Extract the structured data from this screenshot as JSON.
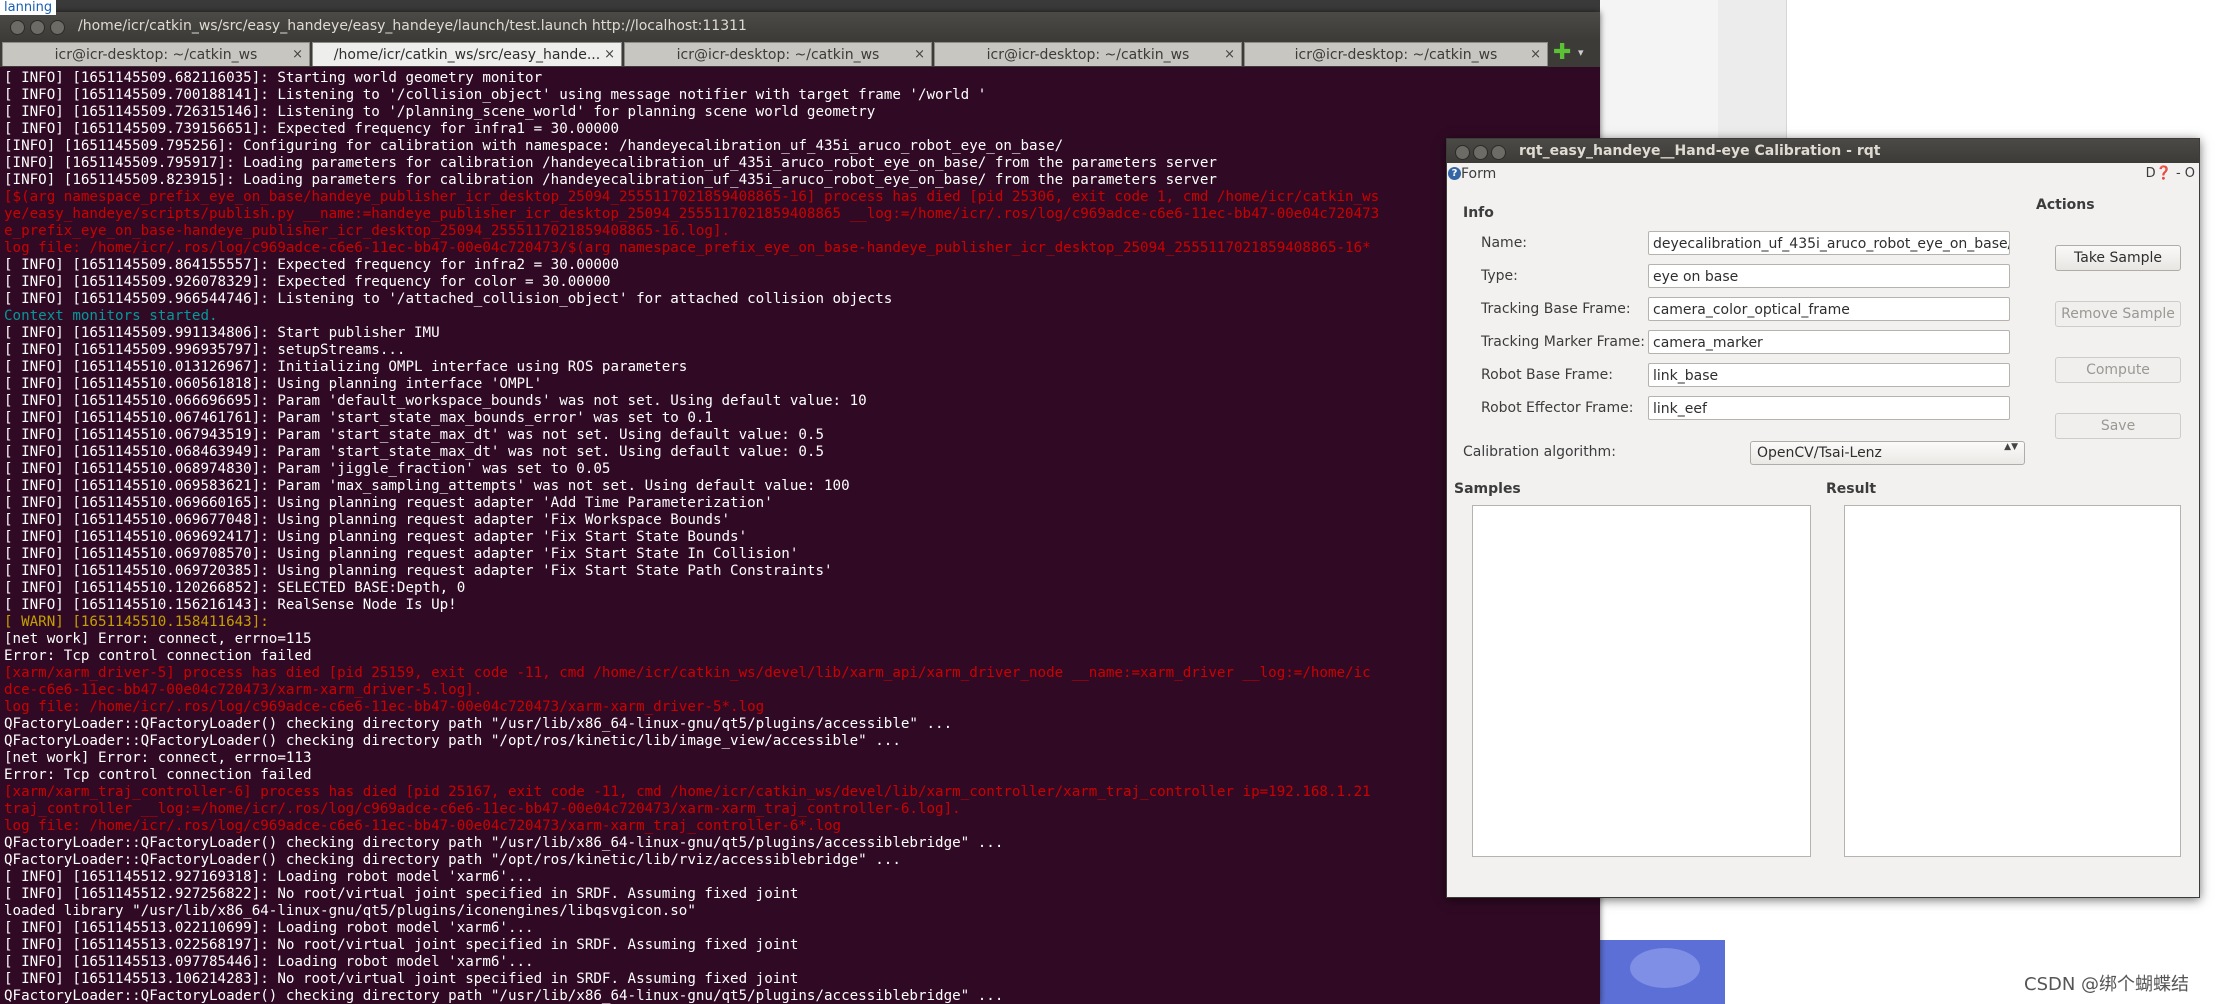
{
  "desktop": {
    "top_left_label": "lanning",
    "watermark": "CSDN @绑个蝴蝶结"
  },
  "terminal": {
    "title": "/home/icr/catkin_ws/src/easy_handeye/easy_handeye/launch/test.launch http://localhost:11311",
    "tabs": [
      {
        "label": "icr@icr-desktop: ~/catkin_ws",
        "close": "×",
        "active": false
      },
      {
        "label": "/home/icr/catkin_ws/src/easy_hande...",
        "close": "×",
        "active": true
      },
      {
        "label": "icr@icr-desktop: ~/catkin_ws",
        "close": "×",
        "active": false
      },
      {
        "label": "icr@icr-desktop: ~/catkin_ws",
        "close": "×",
        "active": false
      },
      {
        "label": "icr@icr-desktop: ~/catkin_ws",
        "close": "×",
        "active": false
      }
    ],
    "add_tab": "✚",
    "tab_menu": "▾",
    "colors": {
      "background": "#300a24",
      "normal": "#ffffff",
      "error": "#cc0000",
      "warn": "#c4a000",
      "info": "#06989a"
    },
    "lines": [
      {
        "t": "[ INFO] [1651145509.682116035]: Starting world geometry monitor",
        "c": "white"
      },
      {
        "t": "[ INFO] [1651145509.700188141]: Listening to '/collision_object' using message notifier with target frame '/world '",
        "c": "white"
      },
      {
        "t": "[ INFO] [1651145509.726315146]: Listening to '/planning_scene_world' for planning scene world geometry",
        "c": "white"
      },
      {
        "t": "[ INFO] [1651145509.739156651]: Expected frequency for infra1 = 30.00000",
        "c": "white"
      },
      {
        "t": "[INFO] [1651145509.795256]: Configuring for calibration with namespace: /handeyecalibration_uf_435i_aruco_robot_eye_on_base/",
        "c": "white"
      },
      {
        "t": "[INFO] [1651145509.795917]: Loading parameters for calibration /handeyecalibration_uf_435i_aruco_robot_eye_on_base/ from the parameters server",
        "c": "white"
      },
      {
        "t": "[INFO] [1651145509.823915]: Loading parameters for calibration /handeyecalibration_uf_435i_aruco_robot_eye_on_base/ from the parameters server",
        "c": "white"
      },
      {
        "t": "[$(arg namespace_prefix_eye_on_base/handeye_publisher_icr_desktop_25094_2555117021859408865-16] process has died [pid 25306, exit code 1, cmd /home/icr/catkin_ws",
        "c": "red"
      },
      {
        "t": "ye/easy_handeye/scripts/publish.py __name:=handeye_publisher_icr_desktop_25094_2555117021859408865 __log:=/home/icr/.ros/log/c969adce-c6e6-11ec-bb47-00e04c720473",
        "c": "red"
      },
      {
        "t": "e_prefix_eye_on_base-handeye_publisher_icr_desktop_25094_2555117021859408865-16.log].",
        "c": "red"
      },
      {
        "t": "log file: /home/icr/.ros/log/c969adce-c6e6-11ec-bb47-00e04c720473/$(arg namespace_prefix_eye_on_base-handeye_publisher_icr_desktop_25094_2555117021859408865-16*",
        "c": "red"
      },
      {
        "t": "[ INFO] [1651145509.864155557]: Expected frequency for infra2 = 30.00000",
        "c": "white"
      },
      {
        "t": "[ INFO] [1651145509.926078329]: Expected frequency for color = 30.00000",
        "c": "white"
      },
      {
        "t": "[ INFO] [1651145509.966544746]: Listening to '/attached_collision_object' for attached collision objects",
        "c": "white"
      },
      {
        "t": "Context monitors started.",
        "c": "cyan"
      },
      {
        "t": "[ INFO] [1651145509.991134806]: Start publisher IMU",
        "c": "white"
      },
      {
        "t": "[ INFO] [1651145509.996935797]: setupStreams...",
        "c": "white"
      },
      {
        "t": "[ INFO] [1651145510.013126967]: Initializing OMPL interface using ROS parameters",
        "c": "white"
      },
      {
        "t": "[ INFO] [1651145510.060561818]: Using planning interface 'OMPL'",
        "c": "white"
      },
      {
        "t": "[ INFO] [1651145510.066696695]: Param 'default_workspace_bounds' was not set. Using default value: 10",
        "c": "white"
      },
      {
        "t": "[ INFO] [1651145510.067461761]: Param 'start_state_max_bounds_error' was set to 0.1",
        "c": "white"
      },
      {
        "t": "[ INFO] [1651145510.067943519]: Param 'start_state_max_dt' was not set. Using default value: 0.5",
        "c": "white"
      },
      {
        "t": "[ INFO] [1651145510.068463949]: Param 'start_state_max_dt' was not set. Using default value: 0.5",
        "c": "white"
      },
      {
        "t": "[ INFO] [1651145510.068974830]: Param 'jiggle_fraction' was set to 0.05",
        "c": "white"
      },
      {
        "t": "[ INFO] [1651145510.069583621]: Param 'max_sampling_attempts' was not set. Using default value: 100",
        "c": "white"
      },
      {
        "t": "[ INFO] [1651145510.069660165]: Using planning request adapter 'Add Time Parameterization'",
        "c": "white"
      },
      {
        "t": "[ INFO] [1651145510.069677048]: Using planning request adapter 'Fix Workspace Bounds'",
        "c": "white"
      },
      {
        "t": "[ INFO] [1651145510.069692417]: Using planning request adapter 'Fix Start State Bounds'",
        "c": "white"
      },
      {
        "t": "[ INFO] [1651145510.069708570]: Using planning request adapter 'Fix Start State In Collision'",
        "c": "white"
      },
      {
        "t": "[ INFO] [1651145510.069720385]: Using planning request adapter 'Fix Start State Path Constraints'",
        "c": "white"
      },
      {
        "t": "[ INFO] [1651145510.120266852]: SELECTED BASE:Depth, 0",
        "c": "white"
      },
      {
        "t": "[ INFO] [1651145510.156216143]: RealSense Node Is Up!",
        "c": "white"
      },
      {
        "t": "[ WARN] [1651145510.158411643]:",
        "c": "yellow"
      },
      {
        "t": "[net work] Error: connect, errno=115",
        "c": "white"
      },
      {
        "t": "Error: Tcp control connection failed",
        "c": "white"
      },
      {
        "t": "[xarm/xarm_driver-5] process has died [pid 25159, exit code -11, cmd /home/icr/catkin_ws/devel/lib/xarm_api/xarm_driver_node __name:=xarm_driver __log:=/home/ic",
        "c": "red"
      },
      {
        "t": "dce-c6e6-11ec-bb47-00e04c720473/xarm-xarm_driver-5.log].",
        "c": "red"
      },
      {
        "t": "log file: /home/icr/.ros/log/c969adce-c6e6-11ec-bb47-00e04c720473/xarm-xarm_driver-5*.log",
        "c": "red"
      },
      {
        "t": "QFactoryLoader::QFactoryLoader() checking directory path \"/usr/lib/x86_64-linux-gnu/qt5/plugins/accessible\" ...",
        "c": "white"
      },
      {
        "t": "QFactoryLoader::QFactoryLoader() checking directory path \"/opt/ros/kinetic/lib/image_view/accessible\" ...",
        "c": "white"
      },
      {
        "t": "[net work] Error: connect, errno=113",
        "c": "white"
      },
      {
        "t": "Error: Tcp control connection failed",
        "c": "white"
      },
      {
        "t": "[xarm/xarm_traj_controller-6] process has died [pid 25167, exit code -11, cmd /home/icr/catkin_ws/devel/lib/xarm_controller/xarm_traj_controller ip=192.168.1.21",
        "c": "red"
      },
      {
        "t": "traj_controller __log:=/home/icr/.ros/log/c969adce-c6e6-11ec-bb47-00e04c720473/xarm-xarm_traj_controller-6.log].",
        "c": "red"
      },
      {
        "t": "log file: /home/icr/.ros/log/c969adce-c6e6-11ec-bb47-00e04c720473/xarm-xarm_traj_controller-6*.log",
        "c": "red"
      },
      {
        "t": "QFactoryLoader::QFactoryLoader() checking directory path \"/usr/lib/x86_64-linux-gnu/qt5/plugins/accessiblebridge\" ...",
        "c": "white"
      },
      {
        "t": "QFactoryLoader::QFactoryLoader() checking directory path \"/opt/ros/kinetic/lib/rviz/accessiblebridge\" ...",
        "c": "white"
      },
      {
        "t": "[ INFO] [1651145512.927169318]: Loading robot model 'xarm6'...",
        "c": "white"
      },
      {
        "t": "[ INFO] [1651145512.927256822]: No root/virtual joint specified in SRDF. Assuming fixed joint",
        "c": "white"
      },
      {
        "t": "loaded library \"/usr/lib/x86_64-linux-gnu/qt5/plugins/iconengines/libqsvgicon.so\"",
        "c": "white"
      },
      {
        "t": "[ INFO] [1651145513.022110699]: Loading robot model 'xarm6'...",
        "c": "white"
      },
      {
        "t": "[ INFO] [1651145513.022568197]: No root/virtual joint specified in SRDF. Assuming fixed joint",
        "c": "white"
      },
      {
        "t": "[ INFO] [1651145513.097785446]: Loading robot model 'xarm6'...",
        "c": "white"
      },
      {
        "t": "[ INFO] [1651145513.106214283]: No root/virtual joint specified in SRDF. Assuming fixed joint",
        "c": "white"
      },
      {
        "t": "QFactoryLoader::QFactoryLoader() checking directory path \"/usr/lib/x86_64-linux-gnu/qt5/plugins/accessiblebridge\" ...",
        "c": "white"
      }
    ]
  },
  "rqt": {
    "title": "rqt_easy_handeye__Hand-eye Calibration - rqt",
    "form_label": "Form",
    "form_icons": "D❓ - O",
    "info_header": "Info",
    "actions_header": "Actions",
    "fields": {
      "name": {
        "label": "Name:",
        "value": "deyecalibration_uf_435i_aruco_robot_eye_on_base/"
      },
      "type": {
        "label": "Type:",
        "value": "eye on base"
      },
      "tracking_base": {
        "label": "Tracking Base Frame:",
        "value": "camera_color_optical_frame"
      },
      "tracking_marker": {
        "label": "Tracking Marker Frame:",
        "value": "camera_marker"
      },
      "robot_base": {
        "label": "Robot Base Frame:",
        "value": "link_base"
      },
      "robot_effector": {
        "label": "Robot Effector Frame:",
        "value": "link_eef"
      }
    },
    "buttons": {
      "take_sample": "Take Sample",
      "remove_sample": "Remove Sample",
      "compute": "Compute",
      "save": "Save"
    },
    "algorithm": {
      "label": "Calibration algorithm:",
      "selected": "OpenCV/Tsai-Lenz",
      "arrows": "▲▼"
    },
    "samples_header": "Samples",
    "result_header": "Result"
  }
}
